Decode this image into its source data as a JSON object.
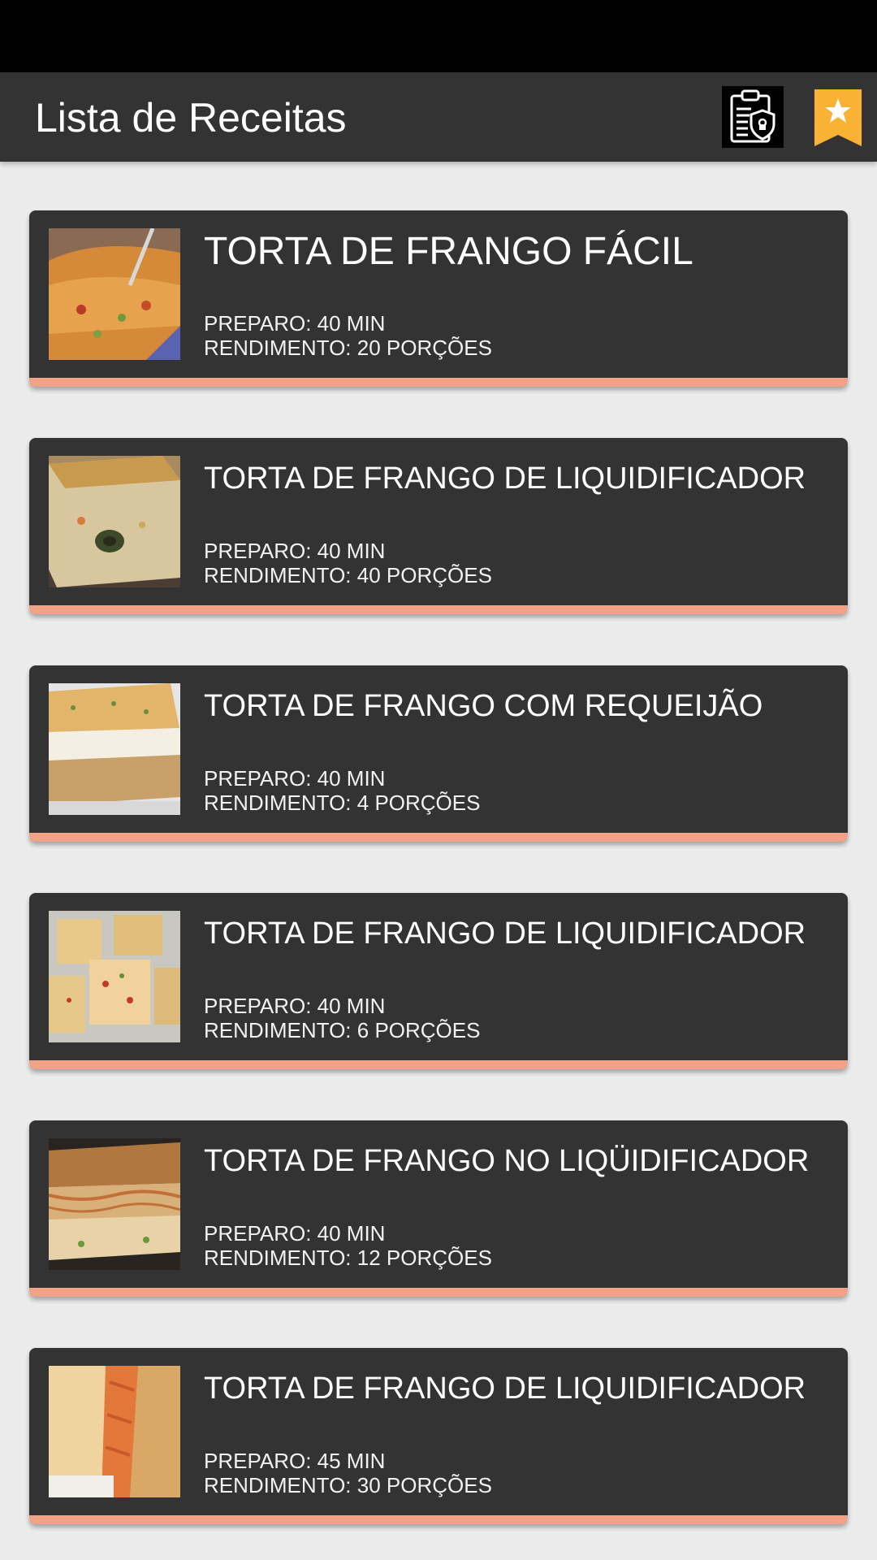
{
  "app": {
    "title": "Lista de Receitas"
  },
  "toolbar": {
    "privacy_icon": "privacy-policy-clipboard-shield-icon",
    "favorites_icon": "bookmark-star-icon",
    "accent_color": "#f9b233"
  },
  "colors": {
    "statusbar": "#000000",
    "appbar": "#333333",
    "card": "#333333",
    "card_accent": "#f2a387",
    "background": "#ebebeb"
  },
  "recipes": [
    {
      "title": "TORTA DE FRANGO FÁCIL",
      "preparo": "PREPARO: 40 MIN",
      "rendimento": "RENDIMENTO: 20 PORÇÕES"
    },
    {
      "title": "TORTA DE FRANGO DE LIQUIDIFICADOR",
      "preparo": "PREPARO: 40 MIN",
      "rendimento": "RENDIMENTO: 40 PORÇÕES"
    },
    {
      "title": "TORTA DE FRANGO COM REQUEIJÃO",
      "preparo": "PREPARO: 40 MIN",
      "rendimento": "RENDIMENTO: 4 PORÇÕES"
    },
    {
      "title": "TORTA DE FRANGO DE LIQUIDIFICADOR",
      "preparo": "PREPARO: 40 MIN",
      "rendimento": "RENDIMENTO: 6 PORÇÕES"
    },
    {
      "title": "TORTA DE FRANGO NO LIQÜIDIFICADOR",
      "preparo": "PREPARO: 40 MIN",
      "rendimento": "RENDIMENTO: 12 PORÇÕES"
    },
    {
      "title": "TORTA DE FRANGO DE LIQUIDIFICADOR",
      "preparo": "PREPARO: 45 MIN",
      "rendimento": "RENDIMENTO: 30 PORÇÕES"
    }
  ]
}
